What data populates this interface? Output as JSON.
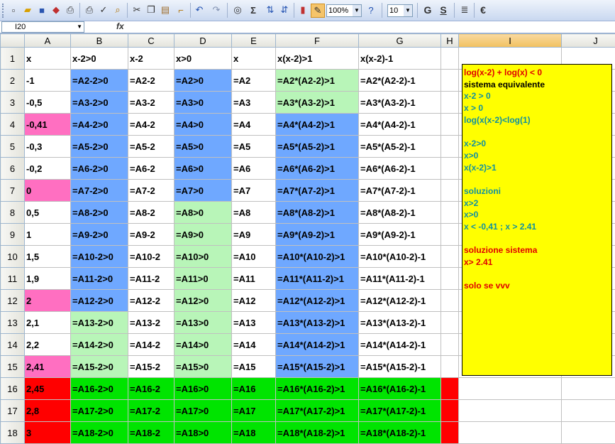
{
  "toolbar": {
    "zoom": "100%",
    "font_size": "10",
    "bold_label": "G",
    "underline_label": "S",
    "euro_label": "€",
    "sum_label": "Σ",
    "icons": [
      "new-icon",
      "open-icon",
      "save-icon",
      "permission-icon",
      "print-icon",
      "print-preview-icon",
      "spelling-icon",
      "research-icon",
      "cut-icon",
      "copy-icon",
      "paste-icon",
      "format-painter-icon",
      "undo-icon",
      "redo-icon",
      "insert-hyperlink-icon",
      "autosum-icon",
      "sort-ascending-icon",
      "sort-descending-icon",
      "chart-icon",
      "drawing-icon",
      "help-icon"
    ]
  },
  "formula_bar": {
    "name_box": "I20",
    "fx_label": "fx",
    "content": ""
  },
  "sheet": {
    "columns": [
      "A",
      "B",
      "C",
      "D",
      "E",
      "F",
      "G",
      "H",
      "I",
      "J"
    ],
    "selected_column": "I",
    "header_row": [
      "x",
      "x-2>0",
      "x-2",
      "x>0",
      "x",
      "x(x-2)>1",
      "x(x-2)-1"
    ],
    "rows": [
      {
        "n": "2",
        "a": "-1",
        "b": "=A2-2>0",
        "c": "=A2-2",
        "d": "=A2>0",
        "e": "=A2",
        "f": "=A2*(A2-2)>1",
        "g": "=A2*(A2-2)-1"
      },
      {
        "n": "3",
        "a": "-0,5",
        "b": "=A3-2>0",
        "c": "=A3-2",
        "d": "=A3>0",
        "e": "=A3",
        "f": "=A3*(A3-2)>1",
        "g": "=A3*(A3-2)-1"
      },
      {
        "n": "4",
        "a": "-0,41",
        "b": "=A4-2>0",
        "c": "=A4-2",
        "d": "=A4>0",
        "e": "=A4",
        "f": "=A4*(A4-2)>1",
        "g": "=A4*(A4-2)-1"
      },
      {
        "n": "5",
        "a": "-0,3",
        "b": "=A5-2>0",
        "c": "=A5-2",
        "d": "=A5>0",
        "e": "=A5",
        "f": "=A5*(A5-2)>1",
        "g": "=A5*(A5-2)-1"
      },
      {
        "n": "6",
        "a": "-0,2",
        "b": "=A6-2>0",
        "c": "=A6-2",
        "d": "=A6>0",
        "e": "=A6",
        "f": "=A6*(A6-2)>1",
        "g": "=A6*(A6-2)-1"
      },
      {
        "n": "7",
        "a": "0",
        "b": "=A7-2>0",
        "c": "=A7-2",
        "d": "=A7>0",
        "e": "=A7",
        "f": "=A7*(A7-2)>1",
        "g": "=A7*(A7-2)-1"
      },
      {
        "n": "8",
        "a": "0,5",
        "b": "=A8-2>0",
        "c": "=A8-2",
        "d": "=A8>0",
        "e": "=A8",
        "f": "=A8*(A8-2)>1",
        "g": "=A8*(A8-2)-1"
      },
      {
        "n": "9",
        "a": "1",
        "b": "=A9-2>0",
        "c": "=A9-2",
        "d": "=A9>0",
        "e": "=A9",
        "f": "=A9*(A9-2)>1",
        "g": "=A9*(A9-2)-1"
      },
      {
        "n": "10",
        "a": "1,5",
        "b": "=A10-2>0",
        "c": "=A10-2",
        "d": "=A10>0",
        "e": "=A10",
        "f": "=A10*(A10-2)>1",
        "g": "=A10*(A10-2)-1"
      },
      {
        "n": "11",
        "a": "1,9",
        "b": "=A11-2>0",
        "c": "=A11-2",
        "d": "=A11>0",
        "e": "=A11",
        "f": "=A11*(A11-2)>1",
        "g": "=A11*(A11-2)-1"
      },
      {
        "n": "12",
        "a": "2",
        "b": "=A12-2>0",
        "c": "=A12-2",
        "d": "=A12>0",
        "e": "=A12",
        "f": "=A12*(A12-2)>1",
        "g": "=A12*(A12-2)-1"
      },
      {
        "n": "13",
        "a": "2,1",
        "b": "=A13-2>0",
        "c": "=A13-2",
        "d": "=A13>0",
        "e": "=A13",
        "f": "=A13*(A13-2)>1",
        "g": "=A13*(A13-2)-1"
      },
      {
        "n": "14",
        "a": "2,2",
        "b": "=A14-2>0",
        "c": "=A14-2",
        "d": "=A14>0",
        "e": "=A14",
        "f": "=A14*(A14-2)>1",
        "g": "=A14*(A14-2)-1"
      },
      {
        "n": "15",
        "a": "2,41",
        "b": "=A15-2>0",
        "c": "=A15-2",
        "d": "=A15>0",
        "e": "=A15",
        "f": "=A15*(A15-2)>1",
        "g": "=A15*(A15-2)-1"
      },
      {
        "n": "16",
        "a": "2,45",
        "b": "=A16-2>0",
        "c": "=A16-2",
        "d": "=A16>0",
        "e": "=A16",
        "f": "=A16*(A16-2)>1",
        "g": "=A16*(A16-2)-1"
      },
      {
        "n": "17",
        "a": "2,8",
        "b": "=A17-2>0",
        "c": "=A17-2",
        "d": "=A17>0",
        "e": "=A17",
        "f": "=A17*(A17-2)>1",
        "g": "=A17*(A17-2)-1"
      },
      {
        "n": "18",
        "a": "3",
        "b": "=A18-2>0",
        "c": "=A18-2",
        "d": "=A18>0",
        "e": "=A18",
        "f": "=A18*(A18-2)>1",
        "g": "=A18*(A18-2)-1"
      }
    ]
  },
  "note": {
    "lines": [
      {
        "text": "log(x-2) + log(x)  < 0",
        "color": "red"
      },
      {
        "text": "sistema equivalente",
        "color": "black"
      },
      {
        "text": "x-2 > 0",
        "color": "teal"
      },
      {
        "text": "x > 0",
        "color": "teal"
      },
      {
        "text": "log(x(x-2)<log(1)",
        "color": "teal"
      },
      {
        "text": "",
        "color": "teal"
      },
      {
        "text": "x-2>0",
        "color": "teal"
      },
      {
        "text": "x>0",
        "color": "teal"
      },
      {
        "text": "x(x-2)>1",
        "color": "teal"
      },
      {
        "text": "",
        "color": "teal"
      },
      {
        "text": "soluzioni",
        "color": "teal"
      },
      {
        "text": "x>2",
        "color": "teal"
      },
      {
        "text": "x>0",
        "color": "teal"
      },
      {
        "text": "x < -0,41 ; x > 2.41",
        "color": "teal"
      },
      {
        "text": "",
        "color": "teal"
      },
      {
        "text": "soluzione sistema",
        "color": "red"
      },
      {
        "text": "x> 2.41",
        "color": "red"
      },
      {
        "text": "",
        "color": "red"
      },
      {
        "text": "solo se vvv",
        "color": "red"
      }
    ]
  },
  "colors": {
    "blue": "#6fa8ff",
    "light_green": "#b8f5b8",
    "pink": "#ff6fc1",
    "green": "#00e400",
    "red": "#ff0000",
    "note_yellow": "#ffff00"
  }
}
